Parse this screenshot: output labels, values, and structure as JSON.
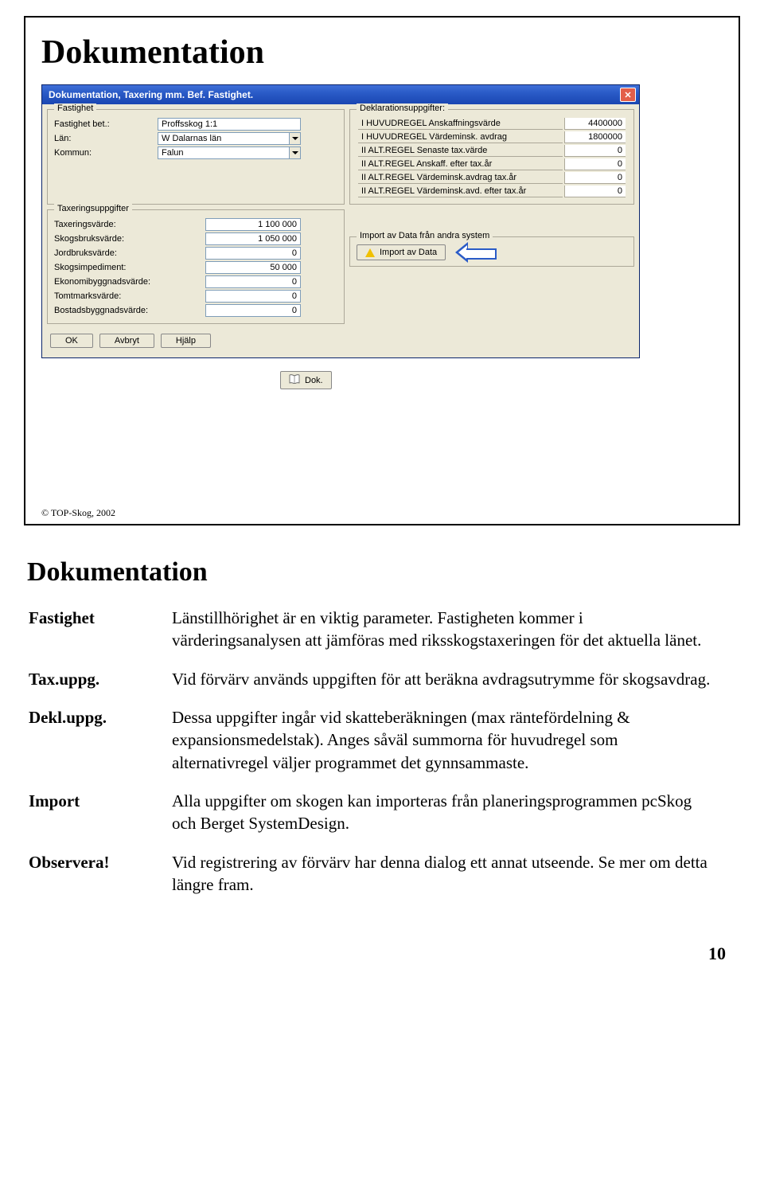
{
  "slide": {
    "title": "Dokumentation",
    "copyright": "© TOP-Skog, 2002"
  },
  "dialog": {
    "title": "Dokumentation, Taxering mm. Bef. Fastighet.",
    "fastighet": {
      "group": "Fastighet",
      "bet_label": "Fastighet bet.:",
      "bet_value": "Proffsskog 1:1",
      "lan_label": "Län:",
      "lan_value": "W Dalarnas län",
      "kommun_label": "Kommun:",
      "kommun_value": "Falun"
    },
    "taxering": {
      "group": "Taxeringsuppgifter",
      "rows": [
        {
          "label": "Taxeringsvärde:",
          "value": "1 100 000"
        },
        {
          "label": "Skogsbruksvärde:",
          "value": "1 050 000"
        },
        {
          "label": "Jordbruksvärde:",
          "value": "0"
        },
        {
          "label": "Skogsimpediment:",
          "value": "50 000"
        },
        {
          "label": "Ekonomibyggnadsvärde:",
          "value": "0"
        },
        {
          "label": "Tomtmarksvärde:",
          "value": "0"
        },
        {
          "label": "Bostadsbyggnadsvärde:",
          "value": "0"
        }
      ]
    },
    "deklaration": {
      "group": "Deklarationsuppgifter:",
      "rows": [
        {
          "label": "I  HUVUDREGEL Anskaffningsvärde",
          "value": "4400000"
        },
        {
          "label": "I  HUVUDREGEL Värdeminsk. avdrag",
          "value": "1800000"
        },
        {
          "label": "II ALT.REGEL Senaste tax.värde",
          "value": "0"
        },
        {
          "label": "II ALT.REGEL Anskaff. efter tax.år",
          "value": "0"
        },
        {
          "label": "II ALT.REGEL Värdeminsk.avdrag tax.år",
          "value": "0"
        },
        {
          "label": "II ALT.REGEL Värdeminsk.avd. efter tax.år",
          "value": "0"
        }
      ]
    },
    "import": {
      "group": "Import av Data från andra system",
      "button": "Import av Data"
    },
    "buttons": {
      "ok": "OK",
      "cancel": "Avbryt",
      "help": "Hjälp"
    },
    "dok_button": "Dok."
  },
  "body": {
    "heading": "Dokumentation",
    "rows": [
      {
        "label": "Fastighet",
        "text": "Länstillhörighet är en viktig parameter. Fastigheten kommer i värderingsanalysen att jämföras med riksskogstaxeringen för det aktuella länet."
      },
      {
        "label": "Tax.uppg.",
        "text": "Vid förvärv används uppgiften för att beräkna avdragsutrymme för skogsavdrag."
      },
      {
        "label": "Dekl.uppg.",
        "text": "Dessa uppgifter ingår vid skatteberäkningen (max ränte­fördelning & expansionsmedelstak). Anges såväl summorna för huvudregel som alternativregel väljer programmet det gynnsammaste."
      },
      {
        "label": "Import",
        "text": "Alla uppgifter om skogen kan importeras från planeringsprogrammen pcSkog och Berget SystemDesign."
      },
      {
        "label": "Observera!",
        "text": "Vid registrering av förvärv har denna dialog ett annat utseende. Se mer om detta längre fram."
      }
    ]
  },
  "page_number": "10"
}
